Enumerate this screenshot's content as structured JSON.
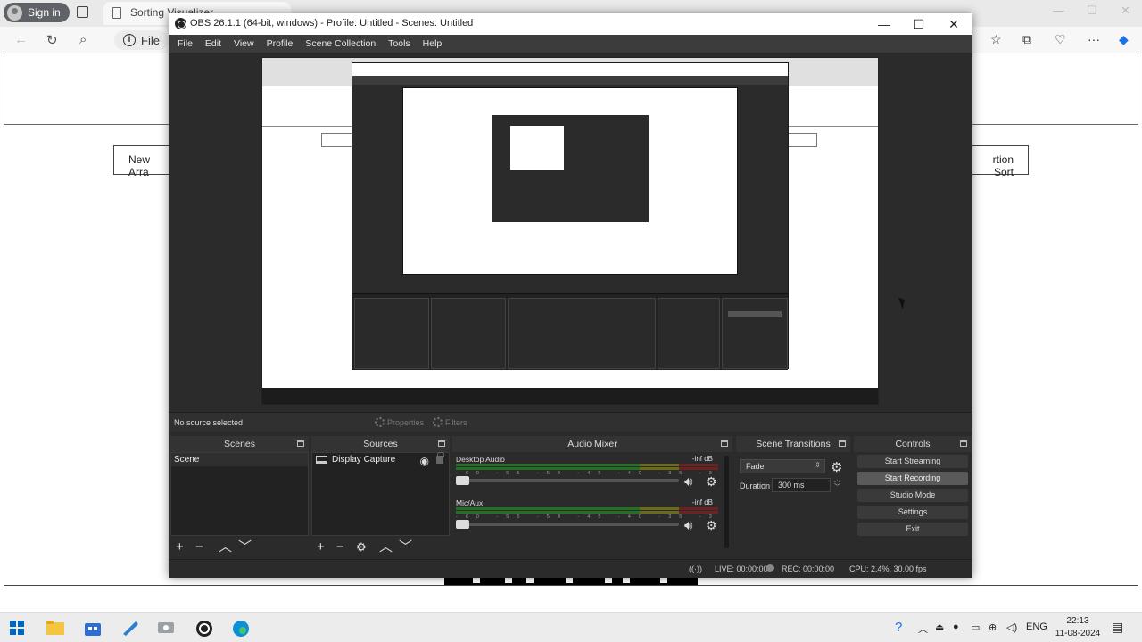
{
  "browser": {
    "signin_label": "Sign in",
    "tab_title": "Sorting Visualizer",
    "url_prefix": "File",
    "left_button_label": "New Arra",
    "right_button_label": "rtion Sort"
  },
  "obs": {
    "title": "OBS 26.1.1 (64-bit, windows) - Profile: Untitled - Scenes: Untitled",
    "menu": [
      "File",
      "Edit",
      "View",
      "Profile",
      "Scene Collection",
      "Tools",
      "Help"
    ],
    "toolbar": {
      "no_source": "No source selected",
      "properties": "Properties",
      "filters": "Filters"
    },
    "scenes": {
      "header": "Scenes",
      "items": [
        "Scene"
      ]
    },
    "sources": {
      "header": "Sources",
      "items": [
        "Display Capture"
      ]
    },
    "mixer": {
      "header": "Audio Mixer",
      "channels": [
        {
          "name": "Desktop Audio",
          "db": "-inf dB",
          "level": 0
        },
        {
          "name": "Mic/Aux",
          "db": "-inf dB",
          "level": 0
        }
      ],
      "ticks": "-60 -55 -50 -45 -40 -35 -30 -25 -20 -15 -10 -5 0"
    },
    "transitions": {
      "header": "Scene Transitions",
      "selected": "Fade",
      "duration_label": "Duration",
      "duration_value": "300 ms"
    },
    "controls": {
      "header": "Controls",
      "buttons": [
        "Start Streaming",
        "Start Recording",
        "Studio Mode",
        "Settings",
        "Exit"
      ]
    },
    "status": {
      "live": "LIVE: 00:00:00",
      "rec": "REC: 00:00:00",
      "cpu": "CPU: 2.4%, 30.00 fps"
    }
  },
  "taskbar": {
    "lang": "ENG",
    "time": "22:13",
    "date": "11-08-2024"
  }
}
